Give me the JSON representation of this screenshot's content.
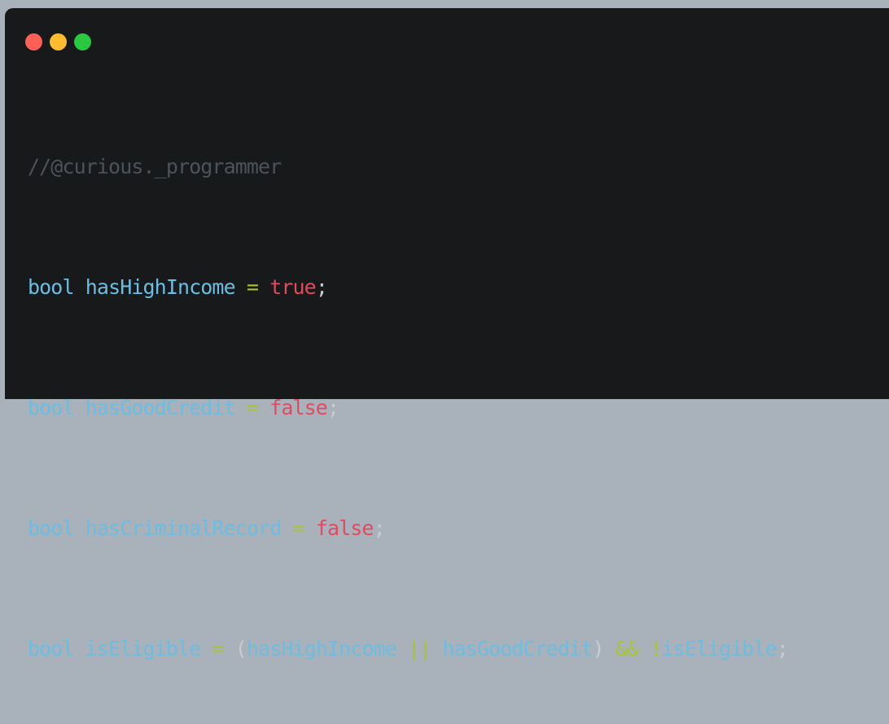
{
  "window": {
    "colors": {
      "background": "#18191b",
      "close": "#fe5f57",
      "minimize": "#febc2e",
      "maximize": "#28c840",
      "keyword": "#6bbde2",
      "operator": "#a7c43a",
      "literal": "#e04b5f",
      "comment": "#4d535b"
    }
  },
  "code": {
    "comment": "//@curious._programmer",
    "lines": [
      {
        "type": "bool",
        "name": "hasHighIncome",
        "eq": "=",
        "value": "true",
        "end": ";"
      },
      {
        "type": "bool",
        "name": "hasGoodCredit",
        "eq": "=",
        "value": "false",
        "end": ";"
      },
      {
        "type": "bool",
        "name": "hasCriminalRecord",
        "eq": "=",
        "value": "false",
        "end": ";"
      }
    ],
    "last_line": {
      "type": "bool",
      "name": "isEligible",
      "eq": "=",
      "open_paren": "(",
      "left": "hasHighIncome",
      "or": "||",
      "right": "hasGoodCredit",
      "close_paren": ")",
      "and": "&&",
      "not": "!",
      "operand": "isEligible",
      "end": ";"
    }
  }
}
